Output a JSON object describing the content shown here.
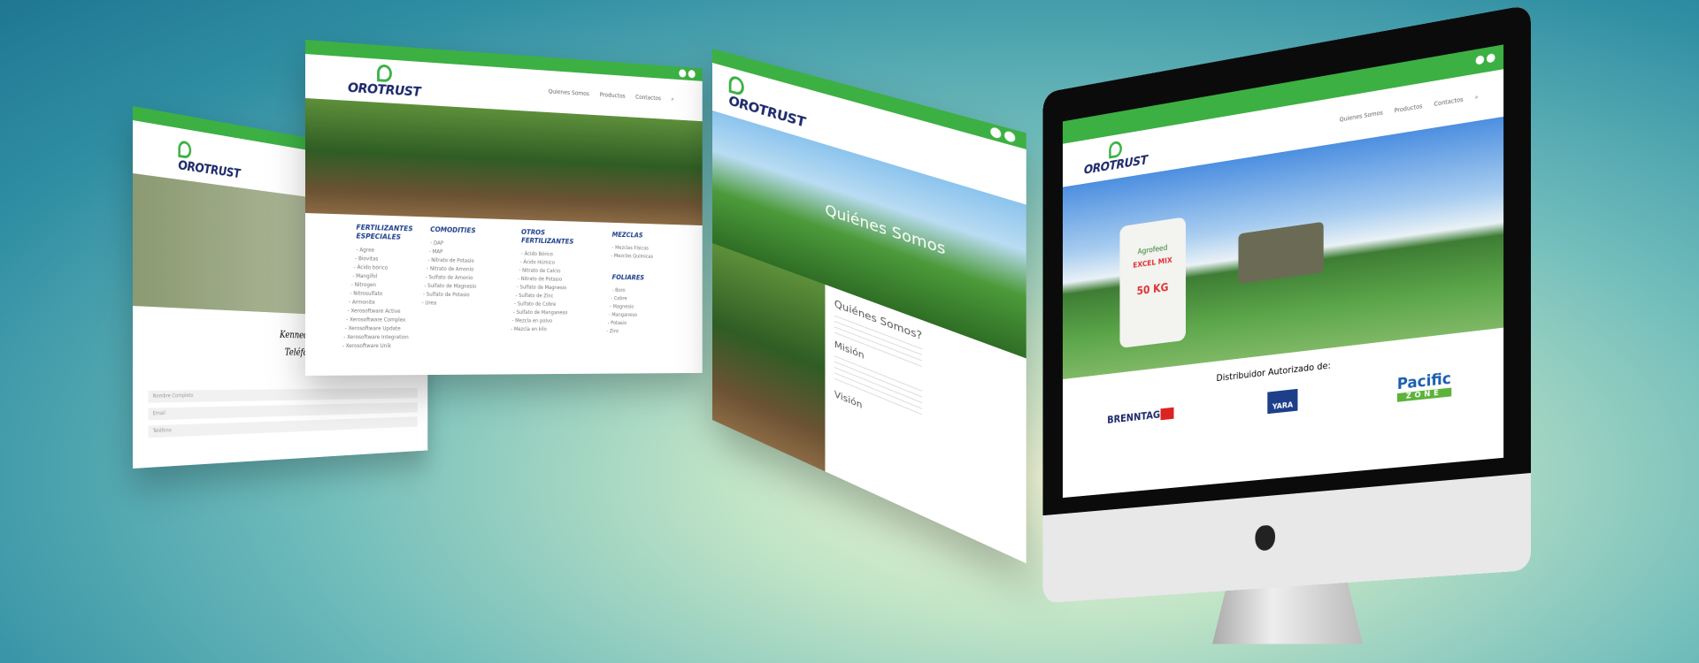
{
  "brand": {
    "logo": "OROTRUST",
    "green": "#3cb043",
    "navy": "#1d2a6b"
  },
  "nav": [
    "Quienes Somos",
    "Productos",
    "Contactos"
  ],
  "left_page": {
    "address": "Kennedy",
    "phone": "Teléfo",
    "form_fields": [
      "Nombre Completo",
      "Email",
      "Teléfono"
    ]
  },
  "menu_page": {
    "columns": [
      {
        "title": "FERTILIZANTES ESPECIALES",
        "items": [
          "Agree",
          "Biovitas",
          "Ácido bórico",
          "Mangifol",
          "Nitrogen",
          "Nitrosulfato",
          "Armonite",
          "Xerosoftware Active",
          "Xerosoftware Complex",
          "Xerosoftware Update",
          "Xerosoftware Integration",
          "Xerosoftware Unik"
        ]
      },
      {
        "title": "COMODITIES",
        "items": [
          "DAP",
          "MAP",
          "Nitrato de Potasio",
          "Nitrato de Amonio",
          "Sulfato de Amonio",
          "Sulfato de Magnesio",
          "Sulfato de Potasio",
          "Urea"
        ]
      },
      {
        "title": "OTROS FERTILIZANTES",
        "items": [
          "Ácido Bórico",
          "Ácido Húmico",
          "Nitrato de Calcio",
          "Nitrato de Potasio",
          "Sulfato de Magnesio",
          "Sulfato de Zinc",
          "Sulfato de Cobre",
          "Sulfato de Manganeso",
          "Mezcla en polvo",
          "Mezcla en kilo"
        ]
      },
      {
        "title": "MEZCLAS",
        "items": [
          "Mezclas Físicas",
          "Mezclas Químicas"
        ]
      },
      {
        "title": "FOLIARES",
        "items": [
          "Boro",
          "Cobre",
          "Magnesio",
          "Manganeso",
          "Potasio",
          "Zinc"
        ]
      }
    ]
  },
  "about_page": {
    "hero": "Quiénes Somos",
    "heading": "Quiénes Somos?",
    "mission": "Misión",
    "vision": "Visión"
  },
  "monitor": {
    "distributor_label": "Distribuidor Autorizado de:",
    "partners": [
      "BRENNTAG",
      "YARA",
      "Pacific",
      "ZONE"
    ],
    "bag_brand": "Agrofeed",
    "bag_product": "EXCEL MIX",
    "bag_weight": "50 KG"
  }
}
